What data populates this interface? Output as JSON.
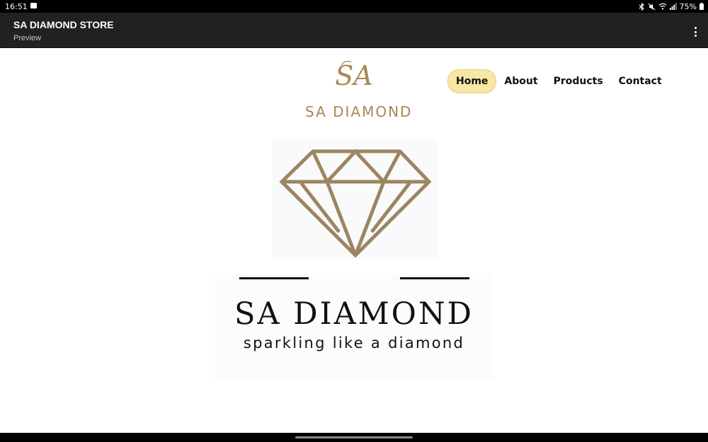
{
  "status_bar": {
    "time": "16:51",
    "battery": "75%",
    "icons": [
      "image-icon",
      "bluetooth-icon",
      "mute-icon",
      "wifi-icon",
      "signal-icon",
      "battery-icon"
    ]
  },
  "app_bar": {
    "title": "SA DIAMOND STORE",
    "subtitle": "Preview",
    "menu_icon": "more-vert-icon"
  },
  "site": {
    "logo_monogram": "SA",
    "logo_text": "SA DIAMOND",
    "nav": [
      {
        "label": "Home",
        "active": true
      },
      {
        "label": "About",
        "active": false
      },
      {
        "label": "Products",
        "active": false
      },
      {
        "label": "Contact",
        "active": false
      }
    ],
    "hero": {
      "title": "SA DIAMOND",
      "tagline": "sparkling like a diamond",
      "icon": "diamond-icon"
    }
  },
  "colors": {
    "gold": "#a88756",
    "diamond_outline": "#9c8563",
    "nav_active_bg": "#f6e7a6",
    "app_bar_bg": "#212121"
  }
}
